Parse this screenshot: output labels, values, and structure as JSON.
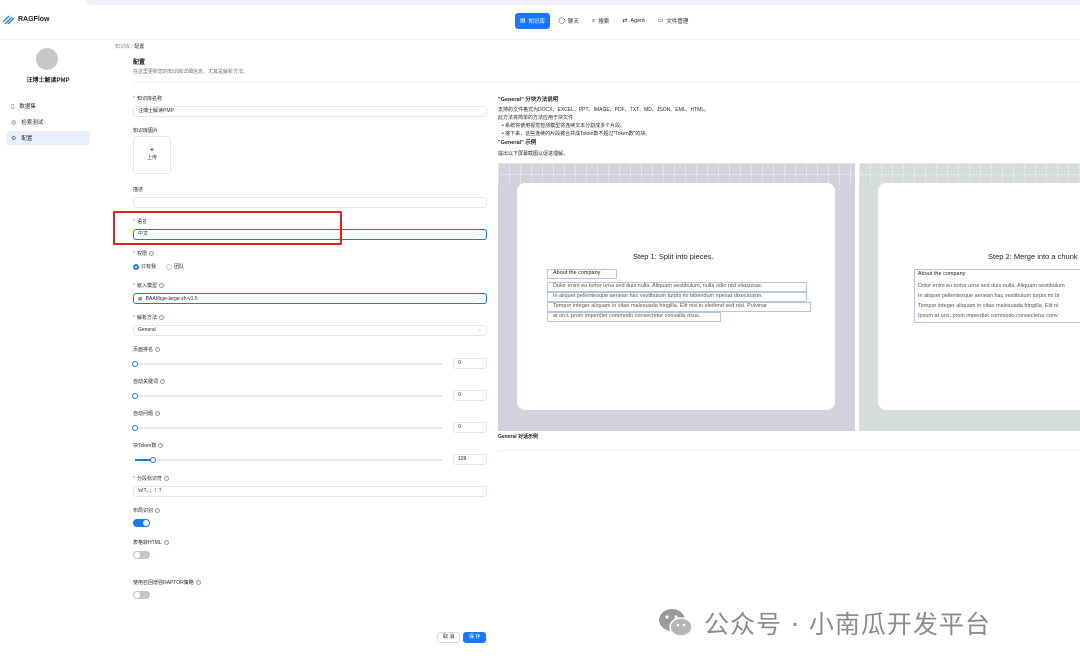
{
  "app": {
    "name": "RAGFlow"
  },
  "nav": {
    "items": [
      {
        "label": "知识库",
        "icon": "database-icon",
        "active": true
      },
      {
        "label": "聊天",
        "icon": "chat-icon",
        "active": false
      },
      {
        "label": "搜索",
        "icon": "search-icon",
        "active": false
      },
      {
        "label": "Agent",
        "icon": "agent-icon",
        "active": false
      },
      {
        "label": "文件管理",
        "icon": "folder-icon",
        "active": false
      }
    ]
  },
  "sidebar": {
    "kb_name": "汪博士解读PMP",
    "items": [
      {
        "label": "数据集",
        "icon": "file-icon",
        "active": false
      },
      {
        "label": "检索测试",
        "icon": "retrieval-icon",
        "active": false
      },
      {
        "label": "配置",
        "icon": "gear-icon",
        "active": true
      }
    ]
  },
  "breadcrumb": {
    "root": "知识库",
    "separator": "/",
    "current": "配置"
  },
  "page": {
    "title": "配置",
    "description": "在这里更新您的知识库详细信息，尤其是解析方法。"
  },
  "form": {
    "kb_name_label": "知识库名称",
    "kb_name_value": "汪博士解读PMP",
    "kb_image_label": "知识库图片",
    "upload_plus": "+",
    "upload_label": "上传",
    "desc_label": "描述",
    "desc_value": "",
    "language_label": "语言",
    "language_value": "中文",
    "permission_label": "权限",
    "permission_options": [
      "只有我",
      "团队"
    ],
    "embedding_label": "嵌入模型",
    "embedding_value": "BAAI/bge-large-zh-v1.5",
    "parser_label": "解析方法",
    "parser_value": "General",
    "page_rank_label": "页面排名",
    "page_rank_value": "0",
    "auto_keywords_label": "自动关键词",
    "auto_keywords_value": "0",
    "auto_questions_label": "自动问题",
    "auto_questions_value": "0",
    "chunk_token_label": "块Token数",
    "chunk_token_value": "128",
    "chunk_token_fraction": 0.06,
    "delimiter_label": "分段标识符",
    "delimiter_value": "\\n!?。；！？",
    "layout_label": "布局识别",
    "layout_on": true,
    "html4excel_label": "表格转HTML",
    "html4excel_on": false,
    "raptor_label": "使用召回增强RAPTOR策略",
    "raptor_on": false,
    "cancel_label": "取 消",
    "save_label": "保 存"
  },
  "right": {
    "title1": "\"General\" 分块方法说明",
    "line1": "支持的文件格式为DOCX、EXCEL、PPT、IMAGE、PDF、TXT、MD、JSON、EML、HTML。",
    "line2": "此方法将简单的方法应用于块文件：",
    "bullet1": "系统将使用视觉检测模型将连续文本分割成多个片段。",
    "bullet2": "接下来，这些连续的片段被合并成Token数不超过\"Token数\"的块。",
    "title2": "\"General\" 示例",
    "line3": "提出以下屏幕截图以促进理解。",
    "footer": "General 对话示例",
    "panel1": {
      "step": "Step 1: Split into pieces.",
      "chunk_title": "About the company",
      "lines": [
        "Dolor enim eu tortor urna sed duis nulla. Aliquam vestibulum, nulla odio nisl vitasusae.",
        "In aliquet pellentesque aenean hac vestibulum turpis mi bibendum npexat dixecauism.",
        "Tempor integer aliquam in vitae malesuada fringilla. Elit nisi in eleifend sed nisi. Pulvinar",
        "at orci, proin imperdiet commodo consectetur convallis risus."
      ]
    },
    "panel2": {
      "step": "Step 2: Merge into a chunk",
      "chunk_title": "About the company",
      "lines": [
        "Dolor enim eu tortor urna sed duis nulla. Aliquam vestibulum",
        "In aliquet pellentesque aenean hac vestibulum turpis mi bi",
        "Tempor integer aliquam in vitae malesuada fringilla. Elit ni",
        "Ipsum at orci, proin imperdiet commodo consectetur conv"
      ]
    }
  },
  "watermark": {
    "text": "公众号 · 小南瓜开发平台",
    "icon": "wechat-icon"
  },
  "colors": {
    "accent": "#1677ff",
    "highlight": "#e02020"
  }
}
